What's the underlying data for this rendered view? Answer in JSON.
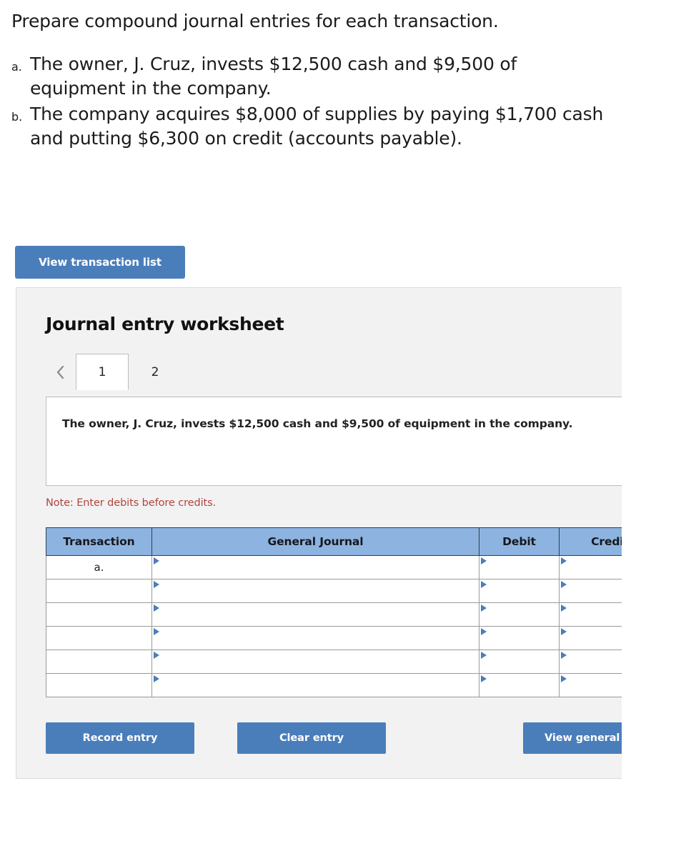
{
  "question": {
    "prompt": "Prepare compound journal entries for each transaction.",
    "items": [
      {
        "marker": "a.",
        "text": "The owner, J. Cruz, invests $12,500 cash and $9,500 of equipment in the company."
      },
      {
        "marker": "b.",
        "text": "The company acquires $8,000 of supplies by paying $1,700 cash and putting $6,300 on credit (accounts payable)."
      }
    ]
  },
  "toolbar": {
    "view_transaction_list_label": "View transaction list"
  },
  "worksheet": {
    "title": "Journal entry worksheet",
    "prev_arrow_icon": "chevron-left-icon",
    "tabs": [
      {
        "label": "1",
        "active": true
      },
      {
        "label": "2",
        "active": false
      }
    ],
    "description": "The owner, J. Cruz, invests $12,500 cash and $9,500 of equipment in the company.",
    "note": "Note: Enter debits before credits.",
    "table": {
      "headers": [
        "Transaction",
        "General Journal",
        "Debit",
        "Credit"
      ],
      "rows": [
        {
          "transaction": "a.",
          "general_journal": "",
          "debit": "",
          "credit": ""
        },
        {
          "transaction": "",
          "general_journal": "",
          "debit": "",
          "credit": ""
        },
        {
          "transaction": "",
          "general_journal": "",
          "debit": "",
          "credit": ""
        },
        {
          "transaction": "",
          "general_journal": "",
          "debit": "",
          "credit": ""
        },
        {
          "transaction": "",
          "general_journal": "",
          "debit": "",
          "credit": ""
        },
        {
          "transaction": "",
          "general_journal": "",
          "debit": "",
          "credit": ""
        }
      ]
    },
    "buttons": {
      "record_entry": "Record entry",
      "clear_entry": "Clear entry",
      "view_general_journal": "View general journal"
    }
  },
  "colors": {
    "button_blue": "#4a7ebb",
    "table_header_blue": "#8db3e0",
    "note_red": "#b1443c",
    "panel_gray": "#f2f2f2"
  }
}
